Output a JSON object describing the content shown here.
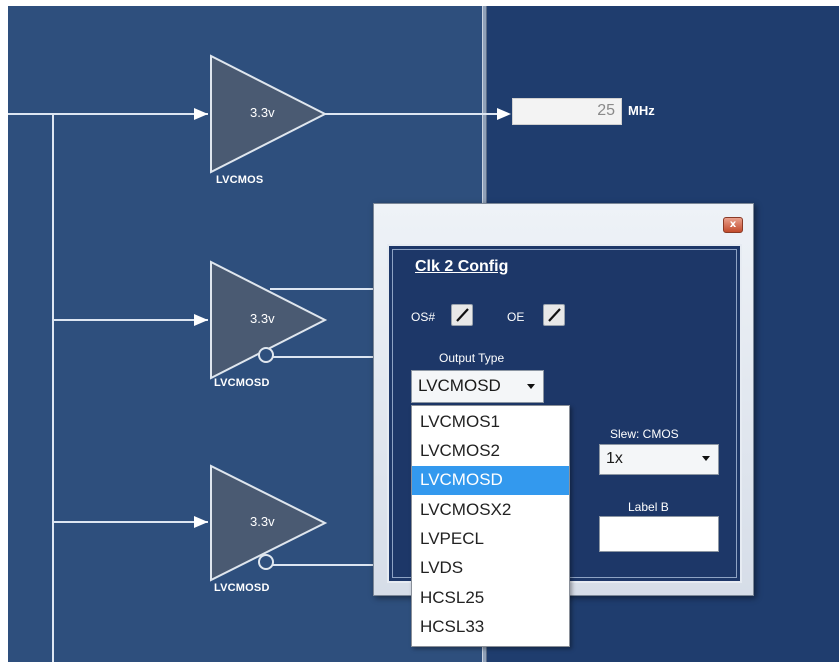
{
  "diagram": {
    "buffers": [
      {
        "voltage": "3.3v",
        "type": "LVCMOS",
        "inverted": false
      },
      {
        "voltage": "3.3v",
        "type": "LVCMOSD",
        "inverted": true
      },
      {
        "voltage": "3.3v",
        "type": "LVCMOSD",
        "inverted": true
      }
    ],
    "output_frequency": {
      "value": "25",
      "unit": "MHz"
    }
  },
  "dialog": {
    "title": "Clk 2 Config",
    "close_label": "x",
    "os_label": "OS#",
    "oe_label": "OE",
    "output_type_label": "Output Type",
    "output_type_value": "LVCMOSD",
    "output_type_options": [
      "LVCMOS1",
      "LVCMOS2",
      "LVCMOSD",
      "LVCMOSX2",
      "LVPECL",
      "LVDS",
      "HCSL25",
      "HCSL33"
    ],
    "selected_option_index": 2,
    "slew_label": "Slew: CMOS",
    "slew_value": "1x",
    "label_b_label": "Label B",
    "label_b_value": ""
  },
  "colors": {
    "left_panel_bg": "#2e4f7d",
    "right_panel_bg": "#1f3d6e",
    "highlight": "#3399ee"
  }
}
